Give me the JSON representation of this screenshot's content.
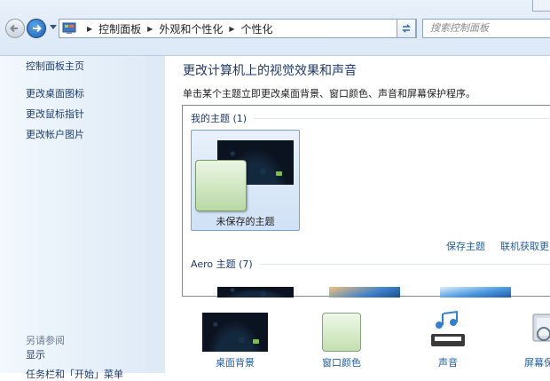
{
  "address_bar": {
    "breadcrumbs": [
      "控制面板",
      "外观和个性化",
      "个性化"
    ],
    "search_placeholder": "搜索控制面板"
  },
  "sidebar": {
    "home_link": "控制面板主页",
    "links": [
      "更改桌面图标",
      "更改鼠标指针",
      "更改帐户图片"
    ],
    "see_also_title": "另请参阅",
    "see_also_links": [
      "显示",
      "任务栏和「开始」菜单"
    ]
  },
  "main": {
    "title": "更改计算机上的视觉效果和声音",
    "subtitle": "单击某个主题立即更改桌面背景、窗口颜色、声音和屏幕保护程序。",
    "my_themes_header": "我的主题 (1)",
    "unsaved_theme_label": "未保存的主题",
    "save_theme_link": "保存主题",
    "online_themes_link": "联机获取更",
    "aero_header": "Aero 主题 (7)"
  },
  "bottom_bar": {
    "items": [
      "桌面背景",
      "窗口颜色",
      "声音",
      "屏幕保"
    ]
  },
  "colors": {
    "accent_link": "#1f5fa6",
    "sidebar_bg": "#dde9f6",
    "title": "#1e3a6e"
  }
}
